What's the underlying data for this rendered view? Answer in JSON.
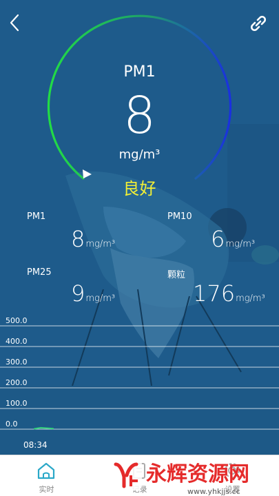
{
  "gauge": {
    "title": "PM1",
    "value": "8",
    "unit": "mg/m³",
    "status": "良好",
    "colors": {
      "arc_start": "#22dd44",
      "arc_end": "#1a2fe0",
      "status": "#f2ef35"
    }
  },
  "metrics": [
    {
      "name": "PM1",
      "value": "8",
      "unit": "mg/m³"
    },
    {
      "name": "PM10",
      "value": "6",
      "unit": "mg/m³"
    },
    {
      "name": "PM25",
      "value": "9",
      "unit": "mg/m³"
    },
    {
      "name": "颗粒",
      "value": "176",
      "unit": "mg/m³"
    }
  ],
  "chart_data": {
    "type": "line",
    "y_ticks": [
      "500.0",
      "400.0",
      "300.0",
      "200.0",
      "100.0",
      "0.0"
    ],
    "ylim": [
      0,
      500
    ],
    "x_labels": [
      "08:34"
    ],
    "series": [
      {
        "values": [
          2,
          7,
          5,
          3
        ]
      }
    ],
    "line_color": "#2fd07a"
  },
  "tabbar": {
    "tabs": [
      {
        "label": "实时",
        "icon": "home-icon"
      },
      {
        "label": "记录",
        "icon": "record-icon"
      },
      {
        "label": "设置",
        "icon": "settings-icon"
      }
    ]
  },
  "watermark": {
    "brand": "永辉资源网",
    "url": "www.yhkjjs.cc"
  }
}
